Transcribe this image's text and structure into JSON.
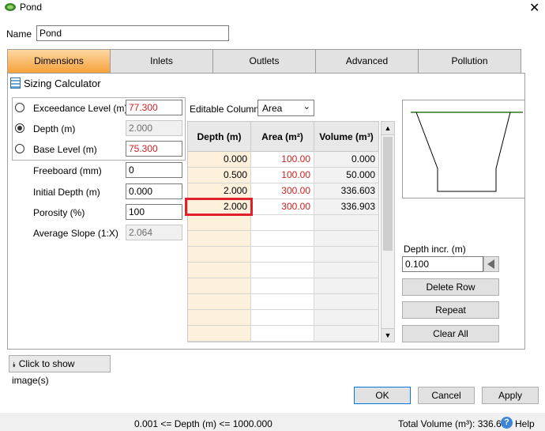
{
  "window": {
    "title": "Pond"
  },
  "name_field": {
    "label": "Name",
    "value": "Pond"
  },
  "tabs": [
    {
      "label": "Dimensions",
      "active": true
    },
    {
      "label": "Inlets",
      "active": false
    },
    {
      "label": "Outlets",
      "active": false
    },
    {
      "label": "Advanced",
      "active": false
    },
    {
      "label": "Pollution",
      "active": false
    }
  ],
  "sizing": {
    "label": "Sizing Calculator"
  },
  "params": {
    "exceedance": {
      "label": "Exceedance Level (m)",
      "value": "77.300",
      "selected": false
    },
    "depth": {
      "label": "Depth (m)",
      "value": "2.000",
      "selected": true
    },
    "base": {
      "label": "Base Level (m)",
      "value": "75.300",
      "selected": false
    },
    "freeboard": {
      "label": "Freeboard (mm)",
      "value": "0"
    },
    "initial_depth": {
      "label": "Initial Depth (m)",
      "value": "0.000"
    },
    "porosity": {
      "label": "Porosity (%)",
      "value": "100"
    },
    "avg_slope": {
      "label": "Average Slope (1:X)",
      "value": "2.064"
    }
  },
  "editable_column": {
    "label": "Editable Column",
    "value": "Area"
  },
  "table": {
    "headers": [
      "Depth (m)",
      "Area (m²)",
      "Volume (m³)"
    ],
    "rows": [
      [
        "0.000",
        "100.00",
        "0.000"
      ],
      [
        "0.500",
        "100.00",
        "50.000"
      ],
      [
        "2.000",
        "300.00",
        "336.603"
      ],
      [
        "2.000",
        "300.00",
        "336.903"
      ]
    ]
  },
  "depth_incr": {
    "label": "Depth incr. (m)",
    "value": "0.100"
  },
  "buttons": {
    "delete_row": "Delete Row",
    "repeat": "Repeat",
    "clear_all": "Clear All",
    "show_images": "Click to show image(s)",
    "ok": "OK",
    "cancel": "Cancel",
    "apply": "Apply"
  },
  "status": {
    "range": "0.001 <= Depth (m) <= 1000.000",
    "total_volume": "Total Volume (m³): 336.603",
    "help": "Help"
  },
  "colors": {
    "active_tab": "#f6a13a",
    "value_red": "#d02020",
    "highlight_box": "#e0202a",
    "depth_column": "#fdf1dc"
  }
}
